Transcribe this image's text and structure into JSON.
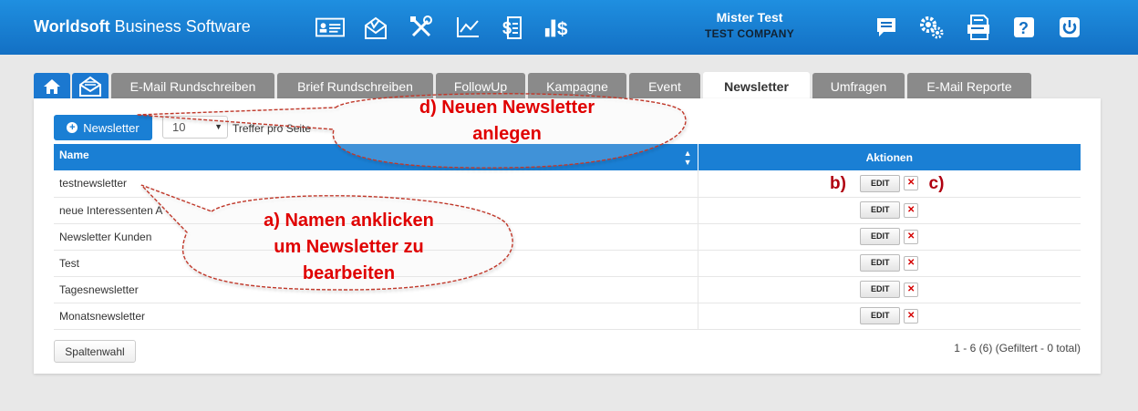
{
  "header": {
    "brand_bold": "Worldsoft",
    "brand_rest": " Business Software",
    "user_name": "Mister Test",
    "company": "TEST COMPANY",
    "left_icons": [
      "contacts-card-icon",
      "mail-marketing-icon",
      "tools-icon",
      "statistics-chart-icon",
      "billing-document-icon",
      "finance-chart-icon"
    ],
    "right_icons": [
      "message-icon",
      "settings-gears-icon",
      "print-document-icon",
      "help-icon",
      "power-icon"
    ]
  },
  "tabs": [
    "E-Mail Rundschreiben",
    "Brief Rundschreiben",
    "FollowUp",
    "Kampagne",
    "Event",
    "Newsletter",
    "Umfragen",
    "E-Mail Reporte"
  ],
  "active_tab": "Newsletter",
  "toolbar": {
    "new_button": "Newsletter",
    "per_page_value": "10",
    "per_page_label": "Treffer pro Seite"
  },
  "table": {
    "col_name": "Name",
    "col_actions": "Aktionen",
    "edit_label": "EDIT",
    "delete_label": "✕",
    "rows": [
      "testnewsletter",
      "neue Interessenten A",
      "Newsletter Kunden",
      "Test",
      "Tagesnewsletter",
      "Monatsnewsletter"
    ]
  },
  "footer": {
    "column_button": "Spaltenwahl",
    "pagination_info": "1 - 6 (6) (Gefiltert - 0 total)"
  },
  "annotations": {
    "a_line1": "a) Namen anklicken",
    "a_line2": "um Newsletter zu",
    "a_line3": "bearbeiten",
    "b": "b)",
    "c": "c)",
    "d_line1": "d) Neuen Newsletter",
    "d_line2": "anlegen"
  },
  "colors": {
    "header_blue": "#1370c4",
    "accent_blue": "#1a7fd4",
    "tab_gray": "#8a8a8a",
    "annotation_red": "#e00000"
  }
}
